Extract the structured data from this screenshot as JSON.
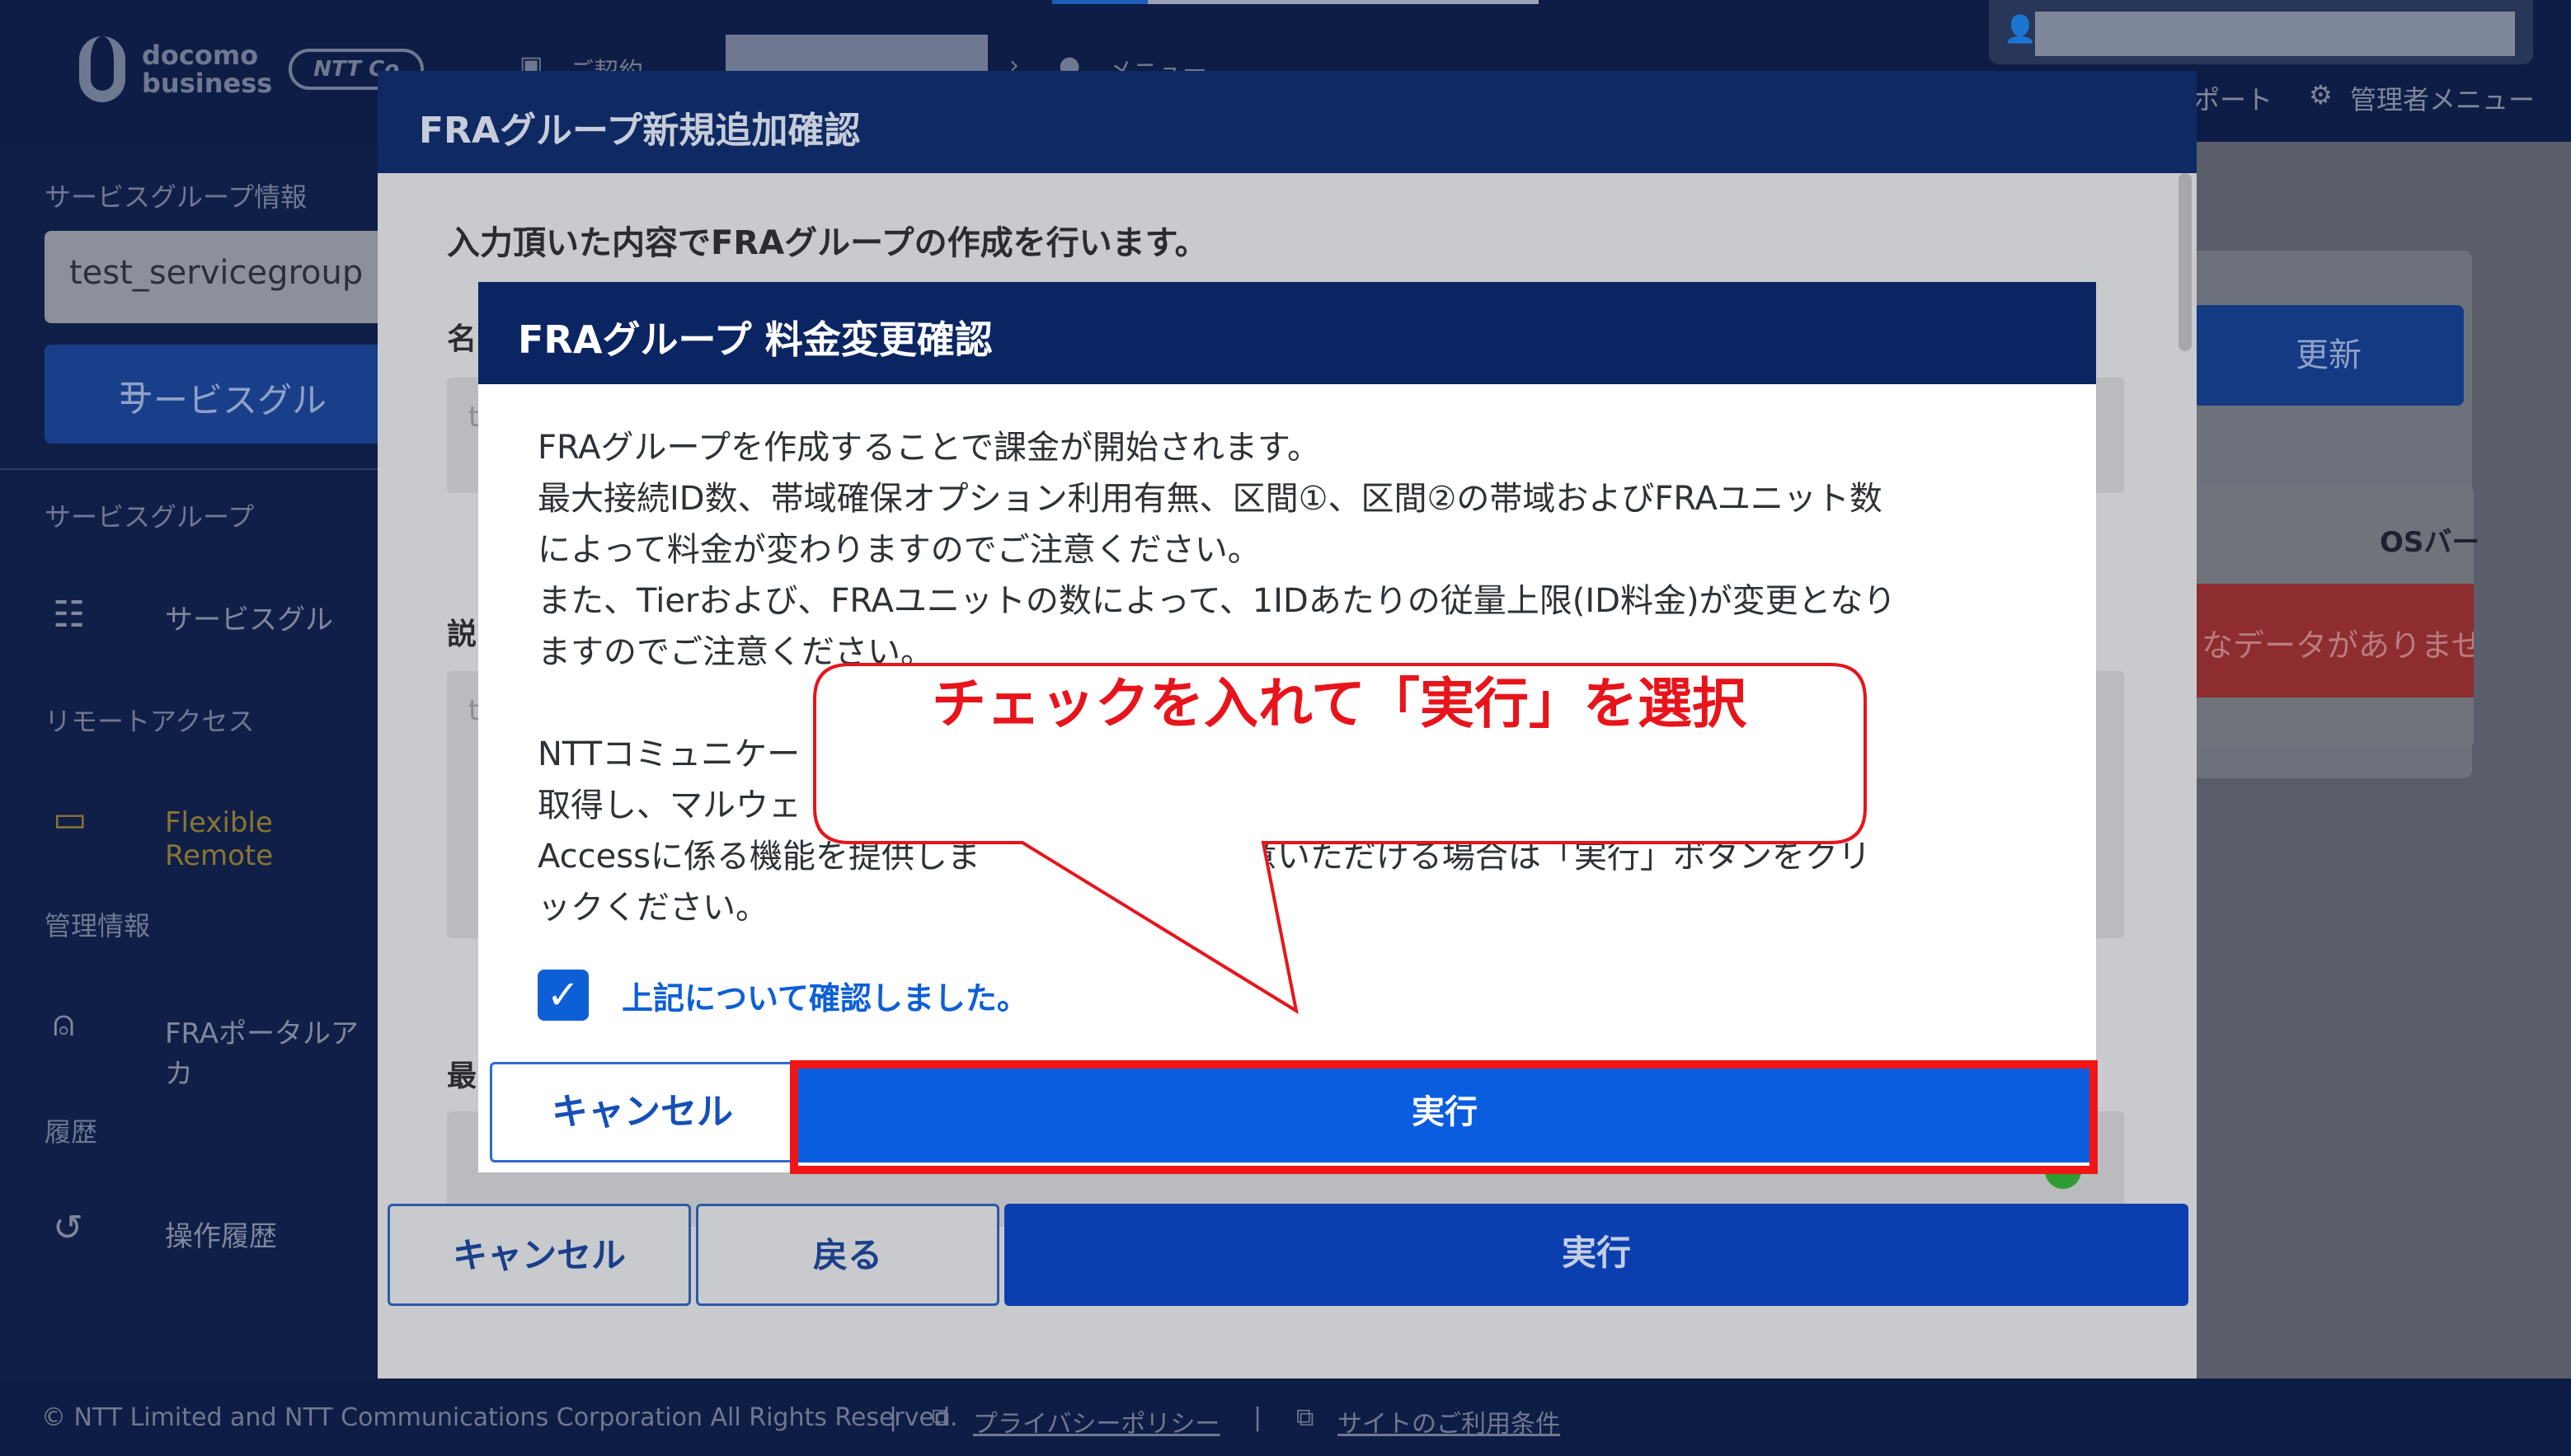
{
  "header": {
    "logo_line1": "docomo",
    "logo_line2": "business",
    "logo_ntt": "NTT Co",
    "crumb_contract": "ご契約",
    "crumb_menu": "メニュー",
    "support": "ポート",
    "admin_menu": "管理者メニュー"
  },
  "sidebar": {
    "service_group_info": "サービスグループ情報",
    "selected_group": "test_servicegroup",
    "group_button": "サービスグル",
    "section_service_group": "サービスグループ",
    "item_service_group": "サービスグル",
    "section_remote": "リモートアクセス",
    "item_fra": "Flexible Remote",
    "section_management": "管理情報",
    "item_portal": "FRAポータルアカ",
    "section_history": "履歴",
    "item_operation_history": "操作履歴"
  },
  "background_page": {
    "update_button": "更新",
    "os_column": "OSバー",
    "no_data": "なデータがありませ"
  },
  "modal1": {
    "title": "FRAグループ新規追加確認",
    "intro": "入力頂いた内容でFRAグループの作成を行います。",
    "label_name": "名",
    "label_desc": "説",
    "label_max": "最",
    "field_placeholder": "t",
    "cancel": "キャンセル",
    "back": "戻る",
    "execute": "実行"
  },
  "modal2": {
    "title": "FRAグループ 料金変更確認",
    "para1": "FRAグループを作成することで課金が開始されます。\n最大接続ID数、帯域確保オプション利用有無、区間①、区間②の帯域およびFRAユニット数\nによって料金が変わりますのでご注意ください。\nまた、Tierおよび、FRAユニットの数によって、1IDあたりの従量上限(ID料金)が変更となり\nますのでご注意ください。",
    "para2": "NTTコミュニケー　　　　　　　　　　　　　　　　　　　　　　　　　　　タ情報を\n取得し、マルウェ　　　　　　　　　　　　　　　　　　　　　　　　　　　Remote\nAccessに係る機能を提供しま　　　　　　に同意いただける場合は「実行」ボタンをクリ\nックください。",
    "checkbox_label": "上記について確認しました。",
    "checked": true,
    "cancel": "キャンセル",
    "execute": "実行"
  },
  "callout": {
    "text": "チェックを入れて「実行」を選択"
  },
  "footer": {
    "copyright": "© NTT Limited and NTT Communications Corporation All Rights Reserved.",
    "privacy": "プライバシーポリシー",
    "terms": "サイトのご利用条件"
  },
  "colors": {
    "header_navy": "#0b2562",
    "primary_blue": "#0b5de0",
    "highlight_red": "#f01616",
    "callout_text": "#e8141b"
  }
}
